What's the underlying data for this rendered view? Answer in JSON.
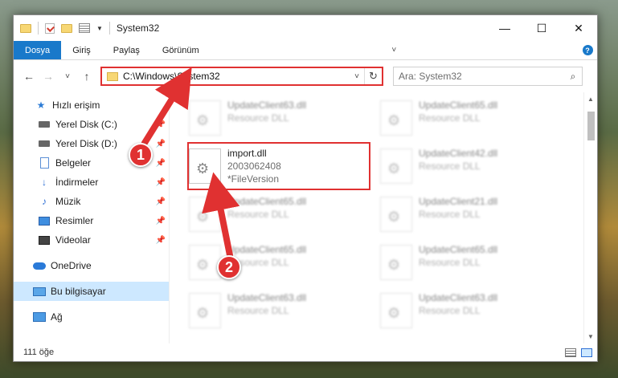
{
  "window": {
    "title": "System32",
    "controls": {
      "minimize": "—",
      "maximize": "☐",
      "close": "✕"
    }
  },
  "ribbon": {
    "tabs": [
      "Dosya",
      "Giriş",
      "Paylaş",
      "Görünüm"
    ],
    "active_tab": "Dosya",
    "expand_icon": "˅",
    "help_icon": "?"
  },
  "navigation": {
    "back_icon": "←",
    "forward_icon": "→",
    "recent_icon": "˅",
    "up_icon": "↑",
    "address": "C:\\Windows\\System32",
    "address_dropdown_icon": "˅",
    "refresh_icon": "↻",
    "search_placeholder": "Ara: System32",
    "search_icon": "⌕"
  },
  "sidebar": {
    "items": [
      {
        "label": "Hızlı erişim",
        "icon": "star-icon"
      },
      {
        "label": "Yerel Disk (C:)",
        "icon": "drive-icon",
        "pinned": true
      },
      {
        "label": "Yerel Disk (D:)",
        "icon": "drive-icon",
        "pinned": true
      },
      {
        "label": "Belgeler",
        "icon": "document-icon",
        "pinned": true
      },
      {
        "label": "İndirmeler",
        "icon": "download-icon",
        "pinned": true
      },
      {
        "label": "Müzik",
        "icon": "music-icon",
        "pinned": true
      },
      {
        "label": "Resimler",
        "icon": "pictures-icon",
        "pinned": true
      },
      {
        "label": "Videolar",
        "icon": "videos-icon",
        "pinned": true
      },
      {
        "label": "OneDrive",
        "icon": "cloud-icon"
      },
      {
        "label": "Bu bilgisayar",
        "icon": "computer-icon",
        "selected": true
      },
      {
        "label": "Ağ",
        "icon": "network-icon"
      }
    ],
    "pin_glyph": "📌"
  },
  "files": {
    "left_column": [
      {
        "name": "UpdateClient63.dll",
        "desc": "Resource DLL",
        "blurred": true
      },
      {
        "name": "import.dll",
        "desc": "2003062408",
        "desc2": "*FileVersion",
        "blurred": false
      },
      {
        "name": "UpdateClient65.dll",
        "desc": "Resource DLL",
        "blurred": true
      },
      {
        "name": "UpdateClient65.dll",
        "desc": "Resource DLL",
        "blurred": true
      },
      {
        "name": "UpdateClient63.dll",
        "desc": "Resource DLL",
        "blurred": true
      }
    ],
    "right_column": [
      {
        "name": "UpdateClient65.dll",
        "desc": "Resource DLL"
      },
      {
        "name": "UpdateClient42.dll",
        "desc": "Resource DLL"
      },
      {
        "name": "UpdateClient21.dll",
        "desc": "Resource DLL"
      },
      {
        "name": "UpdateClient65.dll",
        "desc": "Resource DLL"
      },
      {
        "name": "UpdateClient63.dll",
        "desc": "Resource DLL"
      }
    ]
  },
  "status": {
    "item_count": "111 öğe"
  },
  "annotations": {
    "step1": "1",
    "step2": "2",
    "color": "#e03131"
  }
}
